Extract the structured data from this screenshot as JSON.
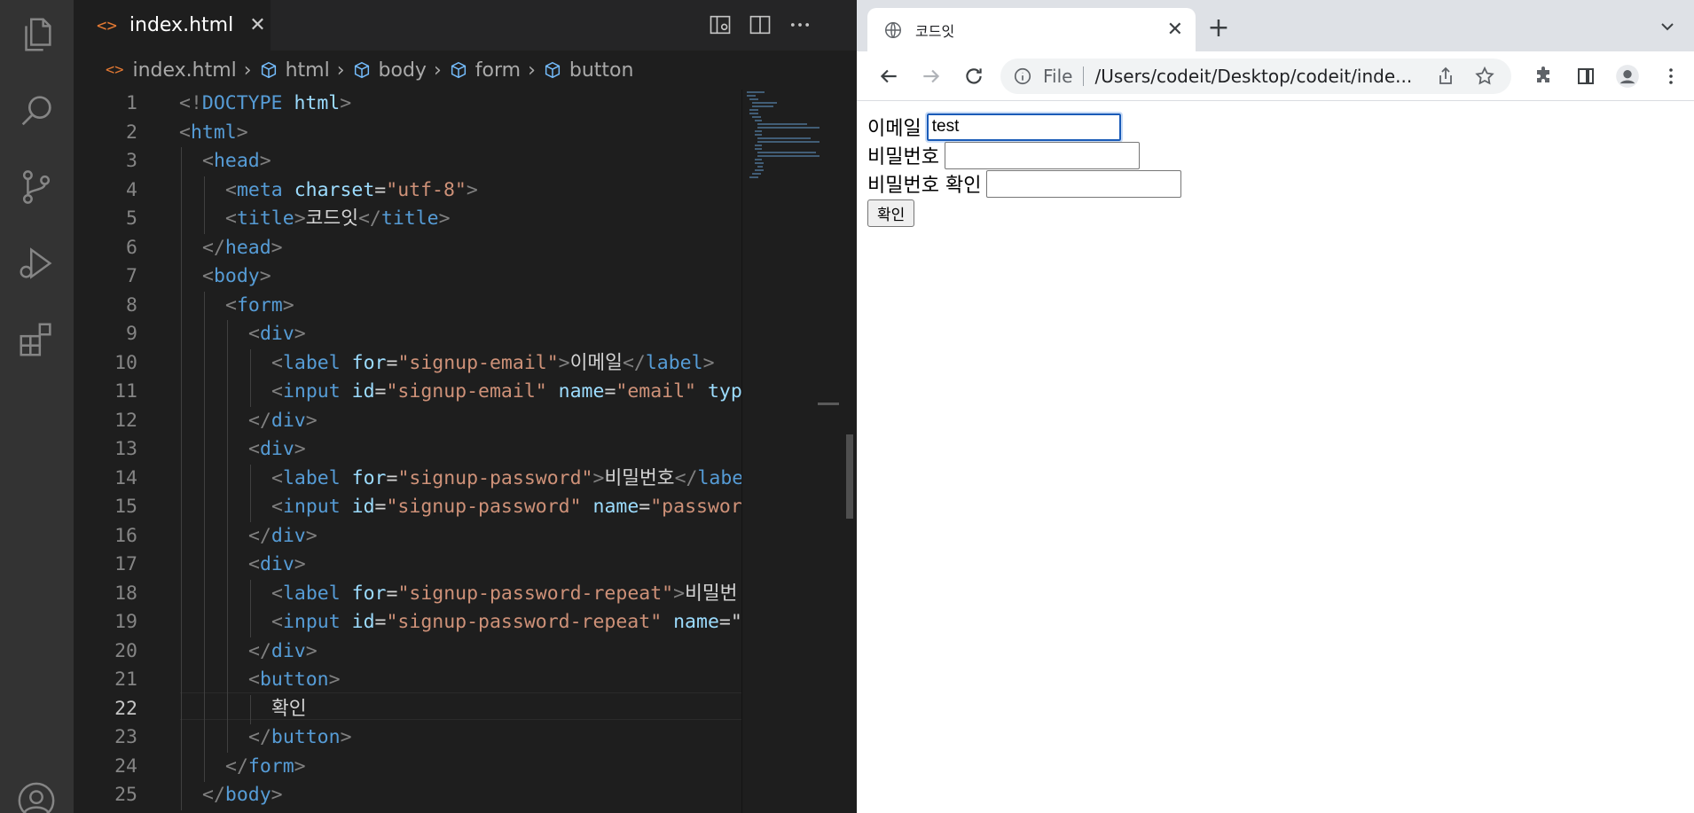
{
  "vscode": {
    "activity_icons": [
      "files-icon",
      "search-icon",
      "source-control-icon",
      "run-debug-icon",
      "extensions-icon",
      "account-icon"
    ],
    "tab": {
      "icon": "<>",
      "label": "index.html",
      "close": "✕"
    },
    "breadcrumb": [
      "index.html",
      "html",
      "body",
      "form",
      "button"
    ],
    "current_line": 22,
    "lines": [
      {
        "n": "1",
        "indent": 0,
        "tokens": [
          [
            "p",
            "<!"
          ],
          [
            "t",
            "DOCTYPE"
          ],
          [
            "x",
            " "
          ],
          [
            "a",
            "html"
          ],
          [
            "p",
            ">"
          ]
        ]
      },
      {
        "n": "2",
        "indent": 0,
        "tokens": [
          [
            "p",
            "<"
          ],
          [
            "t",
            "html"
          ],
          [
            "p",
            ">"
          ]
        ]
      },
      {
        "n": "3",
        "indent": 1,
        "tokens": [
          [
            "p",
            "<"
          ],
          [
            "t",
            "head"
          ],
          [
            "p",
            ">"
          ]
        ]
      },
      {
        "n": "4",
        "indent": 2,
        "tokens": [
          [
            "p",
            "<"
          ],
          [
            "t",
            "meta"
          ],
          [
            "x",
            " "
          ],
          [
            "a",
            "charset"
          ],
          [
            "x",
            "="
          ],
          [
            "s",
            "\"utf-8\""
          ],
          [
            "p",
            ">"
          ]
        ]
      },
      {
        "n": "5",
        "indent": 2,
        "tokens": [
          [
            "p",
            "<"
          ],
          [
            "t",
            "title"
          ],
          [
            "p",
            ">"
          ],
          [
            "x",
            "코드잇"
          ],
          [
            "p",
            "</"
          ],
          [
            "t",
            "title"
          ],
          [
            "p",
            ">"
          ]
        ]
      },
      {
        "n": "6",
        "indent": 1,
        "tokens": [
          [
            "p",
            "</"
          ],
          [
            "t",
            "head"
          ],
          [
            "p",
            ">"
          ]
        ]
      },
      {
        "n": "7",
        "indent": 1,
        "tokens": [
          [
            "p",
            "<"
          ],
          [
            "t",
            "body"
          ],
          [
            "p",
            ">"
          ]
        ]
      },
      {
        "n": "8",
        "indent": 2,
        "tokens": [
          [
            "p",
            "<"
          ],
          [
            "t",
            "form"
          ],
          [
            "p",
            ">"
          ]
        ]
      },
      {
        "n": "9",
        "indent": 3,
        "tokens": [
          [
            "p",
            "<"
          ],
          [
            "t",
            "div"
          ],
          [
            "p",
            ">"
          ]
        ]
      },
      {
        "n": "10",
        "indent": 4,
        "tokens": [
          [
            "p",
            "<"
          ],
          [
            "t",
            "label"
          ],
          [
            "x",
            " "
          ],
          [
            "a",
            "for"
          ],
          [
            "x",
            "="
          ],
          [
            "s",
            "\"signup-email\""
          ],
          [
            "p",
            ">"
          ],
          [
            "x",
            "이메일"
          ],
          [
            "p",
            "</"
          ],
          [
            "t",
            "label"
          ],
          [
            "p",
            ">"
          ]
        ]
      },
      {
        "n": "11",
        "indent": 4,
        "tokens": [
          [
            "p",
            "<"
          ],
          [
            "t",
            "input"
          ],
          [
            "x",
            " "
          ],
          [
            "a",
            "id"
          ],
          [
            "x",
            "="
          ],
          [
            "s",
            "\"signup-email\""
          ],
          [
            "x",
            " "
          ],
          [
            "a",
            "name"
          ],
          [
            "x",
            "="
          ],
          [
            "s",
            "\"email\""
          ],
          [
            "x",
            " "
          ],
          [
            "a",
            "typ"
          ]
        ]
      },
      {
        "n": "12",
        "indent": 3,
        "tokens": [
          [
            "p",
            "</"
          ],
          [
            "t",
            "div"
          ],
          [
            "p",
            ">"
          ]
        ]
      },
      {
        "n": "13",
        "indent": 3,
        "tokens": [
          [
            "p",
            "<"
          ],
          [
            "t",
            "div"
          ],
          [
            "p",
            ">"
          ]
        ]
      },
      {
        "n": "14",
        "indent": 4,
        "tokens": [
          [
            "p",
            "<"
          ],
          [
            "t",
            "label"
          ],
          [
            "x",
            " "
          ],
          [
            "a",
            "for"
          ],
          [
            "x",
            "="
          ],
          [
            "s",
            "\"signup-password\""
          ],
          [
            "p",
            ">"
          ],
          [
            "x",
            "비밀번호"
          ],
          [
            "p",
            "</"
          ],
          [
            "t",
            "labe"
          ]
        ]
      },
      {
        "n": "15",
        "indent": 4,
        "tokens": [
          [
            "p",
            "<"
          ],
          [
            "t",
            "input"
          ],
          [
            "x",
            " "
          ],
          [
            "a",
            "id"
          ],
          [
            "x",
            "="
          ],
          [
            "s",
            "\"signup-password\""
          ],
          [
            "x",
            " "
          ],
          [
            "a",
            "name"
          ],
          [
            "x",
            "="
          ],
          [
            "s",
            "\"passwor"
          ]
        ]
      },
      {
        "n": "16",
        "indent": 3,
        "tokens": [
          [
            "p",
            "</"
          ],
          [
            "t",
            "div"
          ],
          [
            "p",
            ">"
          ]
        ]
      },
      {
        "n": "17",
        "indent": 3,
        "tokens": [
          [
            "p",
            "<"
          ],
          [
            "t",
            "div"
          ],
          [
            "p",
            ">"
          ]
        ]
      },
      {
        "n": "18",
        "indent": 4,
        "tokens": [
          [
            "p",
            "<"
          ],
          [
            "t",
            "label"
          ],
          [
            "x",
            " "
          ],
          [
            "a",
            "for"
          ],
          [
            "x",
            "="
          ],
          [
            "s",
            "\"signup-password-repeat\""
          ],
          [
            "p",
            ">"
          ],
          [
            "x",
            "비밀번"
          ]
        ]
      },
      {
        "n": "19",
        "indent": 4,
        "tokens": [
          [
            "p",
            "<"
          ],
          [
            "t",
            "input"
          ],
          [
            "x",
            " "
          ],
          [
            "a",
            "id"
          ],
          [
            "x",
            "="
          ],
          [
            "s",
            "\"signup-password-repeat\""
          ],
          [
            "x",
            " "
          ],
          [
            "a",
            "name"
          ],
          [
            "x",
            "=\""
          ]
        ]
      },
      {
        "n": "20",
        "indent": 3,
        "tokens": [
          [
            "p",
            "</"
          ],
          [
            "t",
            "div"
          ],
          [
            "p",
            ">"
          ]
        ]
      },
      {
        "n": "21",
        "indent": 3,
        "tokens": [
          [
            "p",
            "<"
          ],
          [
            "t",
            "button"
          ],
          [
            "p",
            ">"
          ]
        ]
      },
      {
        "n": "22",
        "indent": 4,
        "tokens": [
          [
            "x",
            "확인"
          ]
        ]
      },
      {
        "n": "23",
        "indent": 3,
        "tokens": [
          [
            "p",
            "</"
          ],
          [
            "t",
            "button"
          ],
          [
            "p",
            ">"
          ]
        ]
      },
      {
        "n": "24",
        "indent": 2,
        "tokens": [
          [
            "p",
            "</"
          ],
          [
            "t",
            "form"
          ],
          [
            "p",
            ">"
          ]
        ]
      },
      {
        "n": "25",
        "indent": 1,
        "tokens": [
          [
            "p",
            "</"
          ],
          [
            "t",
            "body"
          ],
          [
            "p",
            ">"
          ]
        ]
      }
    ]
  },
  "chrome": {
    "tab_title": "코드잇",
    "tab_close": "✕",
    "new_tab": "+",
    "url_scheme": "File",
    "url": "/Users/codeit/Desktop/codeit/inde...",
    "page": {
      "email_label": "이메일",
      "email_value": "test",
      "password_label": "비밀번호",
      "password_value": "",
      "password_repeat_label": "비밀번호 확인",
      "password_repeat_value": "",
      "submit_label": "확인"
    }
  },
  "colors": {
    "vscode_bg": "#1e1e1e",
    "activity_bar": "#333333",
    "tag": "#569cd6",
    "attr": "#9cdcfe",
    "string": "#ce9178",
    "punct": "#808080",
    "focus_ring": "#1a5bb8"
  }
}
